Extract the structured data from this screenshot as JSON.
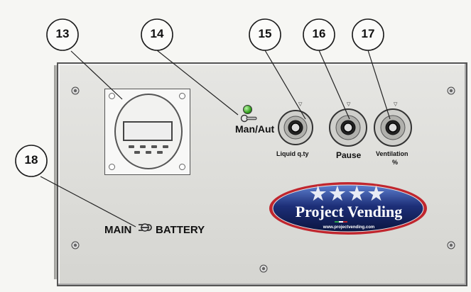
{
  "callouts": {
    "n13": "13",
    "n14": "14",
    "n15": "15",
    "n16": "16",
    "n17": "17",
    "n18": "18"
  },
  "panel": {
    "switch_label": "Man/Aut",
    "knobs": [
      {
        "label": "Liquid q.ty"
      },
      {
        "label": "Pause"
      },
      {
        "label": "Ventilation",
        "unit": "%"
      }
    ],
    "battery_left": "MAIN",
    "battery_right": "BATTERY"
  },
  "logo": {
    "stars": "★★★★",
    "title": "Project Vending",
    "url": "www.projectvending.com"
  },
  "colors": {
    "led": "#35a11f",
    "logo_blue": "#1d2f78",
    "logo_red": "#c0262e"
  },
  "icons": [
    "screw-icon",
    "led-indicator-icon",
    "toggle-switch-icon",
    "knob-icon",
    "battery-switch-icon",
    "timer-icon"
  ]
}
